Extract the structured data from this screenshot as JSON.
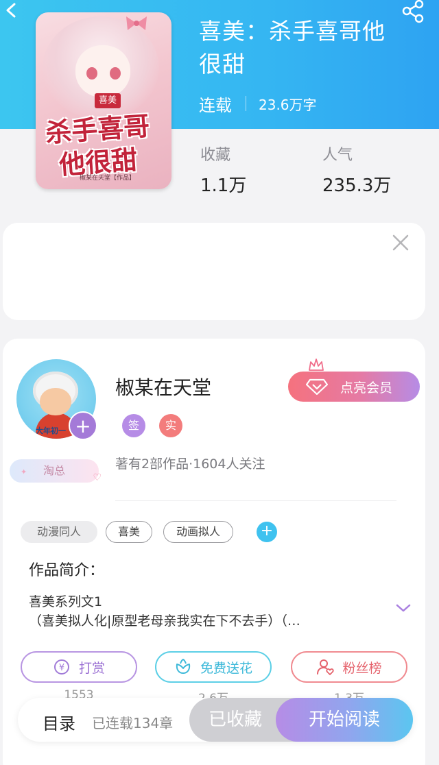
{
  "book": {
    "title": "喜美：杀手喜哥他很甜",
    "status": "连载",
    "words": "23.6万字",
    "cover": {
      "badge": "喜美",
      "title_line1": "杀手喜哥",
      "title_line2": "他很甜",
      "author_credit": "椒某在天堂【作品】"
    }
  },
  "stats": {
    "collect_label": "收藏",
    "collect_value": "1.1万",
    "popularity_label": "人气",
    "popularity_value": "235.3万"
  },
  "author": {
    "name": "椒某在天堂",
    "avatar_caption": "大年初一",
    "badge_sign": "签",
    "badge_real": "实",
    "meta": "著有2部作品·1604人关注",
    "level_tag": "淘总",
    "vip_button": "点亮会员"
  },
  "tags": [
    "动漫同人",
    "喜美",
    "动画拟人"
  ],
  "intro": {
    "label": "作品简介：",
    "line1": "喜美系列文1",
    "line2": "（喜美拟人化|原型老母亲我实在下不去手）（…"
  },
  "actions": [
    {
      "label": "打赏",
      "count": "1553",
      "icon": "yen-coin-icon"
    },
    {
      "label": "免费送花",
      "count": "2.6万",
      "icon": "flower-icon"
    },
    {
      "label": "粉丝榜",
      "count": "1.3万",
      "icon": "user-heart-icon"
    }
  ],
  "bottom_bar": {
    "toc_label": "目录",
    "chapters": "已连载134章",
    "collected": "已收藏",
    "read": "开始阅读"
  },
  "colors": {
    "header_blue": "#35b6f2",
    "accent_purple": "#b68ce6",
    "accent_pink": "#f5727e",
    "accent_cyan": "#3fc2ef"
  }
}
